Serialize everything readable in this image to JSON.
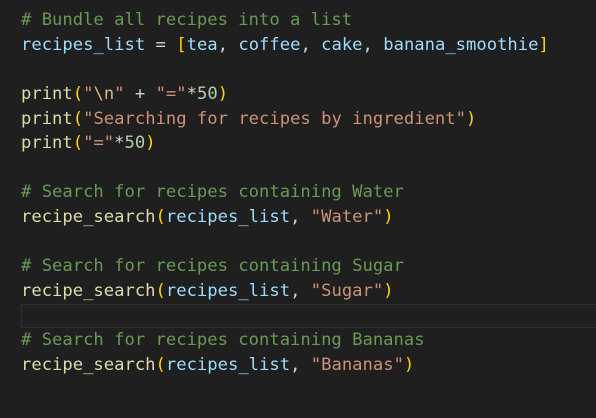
{
  "comments": {
    "bundle": "# Bundle all recipes into a list",
    "water": "# Search for recipes containing Water",
    "sugar": "# Search for recipes containing Sugar",
    "bananas": "# Search for recipes containing Bananas"
  },
  "list_assign": {
    "name": "recipes_list",
    "op": " = ",
    "open": "[",
    "items": [
      "tea",
      "coffee",
      "cake",
      "banana_smoothie"
    ],
    "sep": ", ",
    "close": "]"
  },
  "prints": {
    "func": "print",
    "line1": {
      "str1a": "\"",
      "esc": "\\n",
      "str1b": "\"",
      "plus": " + ",
      "str2": "\"=\"",
      "times": "*",
      "num": "50"
    },
    "line2": {
      "str": "\"Searching for recipes by ingredient\""
    },
    "line3": {
      "str": "\"=\"",
      "times": "*",
      "num": "50"
    }
  },
  "searches": {
    "func": "recipe_search",
    "arg": "recipes_list",
    "sep": ", ",
    "water": "\"Water\"",
    "sugar": "\"Sugar\"",
    "bananas": "\"Bananas\""
  },
  "colors": {
    "background": "#1f1f1f",
    "comment": "#6a9955",
    "variable": "#9cdcfe",
    "function": "#dcdcaa",
    "string": "#ce9178",
    "number": "#b5cea8",
    "bracket_level1": "#ffd700",
    "bracket_level2": "#da70d6"
  }
}
